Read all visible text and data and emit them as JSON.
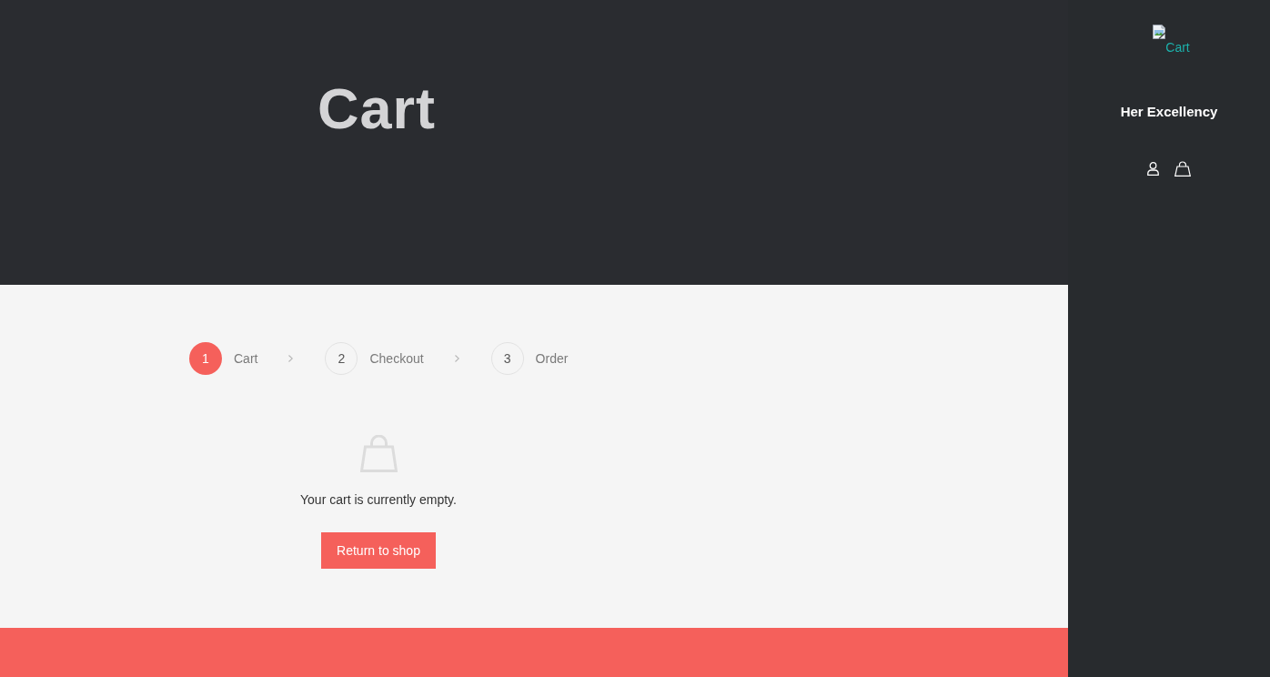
{
  "sidebar": {
    "logo_alt": "Cart",
    "site_title": "Her Excellency"
  },
  "page_title": "Cart",
  "steps": [
    {
      "number": "1",
      "label": "Cart",
      "selected": true
    },
    {
      "number": "2",
      "label": "Checkout",
      "selected": false
    },
    {
      "number": "3",
      "label": "Order",
      "selected": false
    }
  ],
  "empty_cart": {
    "message": "Your cart is currently empty.",
    "button": "Return to shop"
  }
}
